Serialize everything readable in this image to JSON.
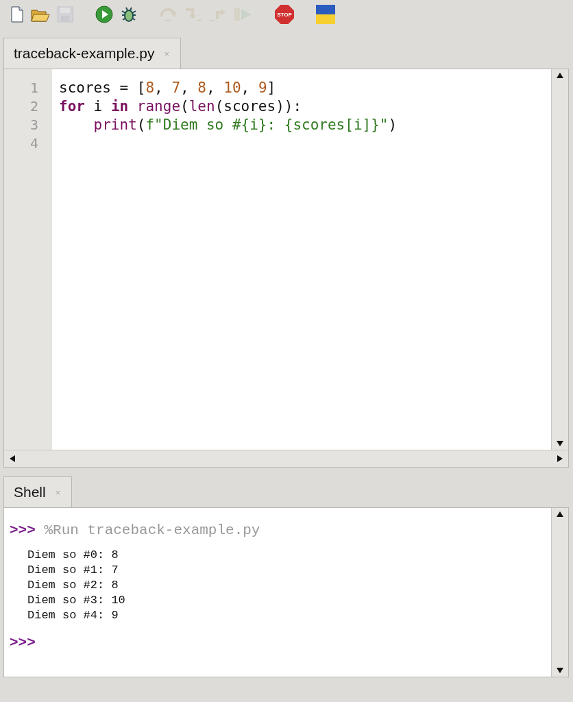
{
  "toolbar": [
    {
      "kind": "new",
      "disabled": false
    },
    {
      "kind": "open",
      "disabled": false
    },
    {
      "kind": "save",
      "disabled": true
    },
    {
      "kind": "run",
      "disabled": false
    },
    {
      "kind": "debug",
      "disabled": false
    },
    {
      "kind": "step-over",
      "disabled": true
    },
    {
      "kind": "step-into",
      "disabled": true
    },
    {
      "kind": "step-out",
      "disabled": true
    },
    {
      "kind": "resume",
      "disabled": true
    },
    {
      "kind": "stop",
      "disabled": false,
      "label": "STOP"
    },
    {
      "kind": "flag",
      "disabled": false
    }
  ],
  "editor_tabs": [
    {
      "label": "traceback-example.py",
      "close": "×",
      "selected": true
    }
  ],
  "editor": {
    "lines": [
      {
        "number": "1",
        "tokens": [
          {
            "kind": "plain",
            "text": "scores = ["
          },
          {
            "kind": "number",
            "text": "8"
          },
          {
            "kind": "plain",
            "text": ", "
          },
          {
            "kind": "number",
            "text": "7"
          },
          {
            "kind": "plain",
            "text": ", "
          },
          {
            "kind": "number",
            "text": "8"
          },
          {
            "kind": "plain",
            "text": ", "
          },
          {
            "kind": "number",
            "text": "10"
          },
          {
            "kind": "plain",
            "text": ", "
          },
          {
            "kind": "number",
            "text": "9"
          },
          {
            "kind": "plain",
            "text": "]"
          }
        ]
      },
      {
        "number": "2",
        "tokens": [
          {
            "kind": "keyword",
            "text": "for"
          },
          {
            "kind": "plain",
            "text": " i "
          },
          {
            "kind": "keyword",
            "text": "in "
          },
          {
            "kind": "builtin",
            "text": "range"
          },
          {
            "kind": "plain",
            "text": "("
          },
          {
            "kind": "builtin",
            "text": "len"
          },
          {
            "kind": "plain",
            "text": "(scores)):"
          }
        ]
      },
      {
        "number": "3",
        "tokens": [
          {
            "kind": "builtin",
            "text": "    print"
          },
          {
            "kind": "plain",
            "text": "("
          },
          {
            "kind": "string",
            "text": "f\"Diem so #{i}: {scores[i]}\""
          },
          {
            "kind": "plain",
            "text": ")"
          }
        ]
      },
      {
        "number": "4"
      }
    ]
  },
  "shell_tabs": [
    {
      "label": "Shell",
      "close": "×",
      "selected": true
    }
  ],
  "shell": {
    "lines": [
      {
        "kind": "command",
        "prompt": ">>>",
        "text": "%Run traceback-example.py"
      },
      {
        "kind": "output",
        "text": "Diem so #0: 8"
      },
      {
        "kind": "output",
        "text": "Diem so #1: 7"
      },
      {
        "kind": "output",
        "text": "Diem so #2: 8"
      },
      {
        "kind": "output",
        "text": "Diem so #3: 10"
      },
      {
        "kind": "output",
        "text": "Diem so #4: 9"
      },
      {
        "kind": "prompt",
        "prompt": ">>>"
      }
    ]
  }
}
